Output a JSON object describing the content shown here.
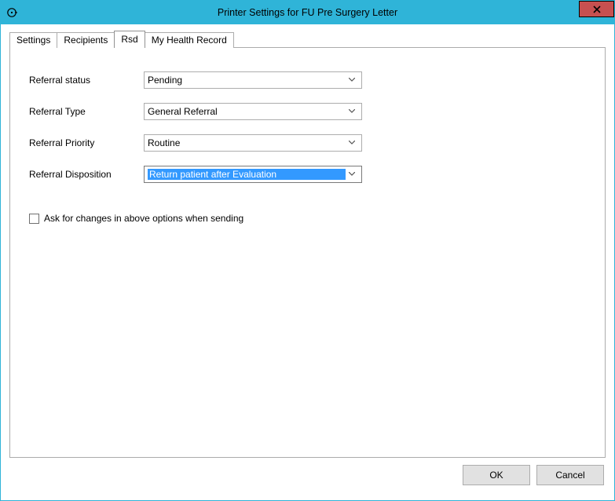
{
  "window": {
    "title": "Printer Settings for FU Pre Surgery Letter"
  },
  "tabs": [
    {
      "label": "Settings",
      "active": false
    },
    {
      "label": "Recipients",
      "active": false
    },
    {
      "label": "Rsd",
      "active": true
    },
    {
      "label": "My Health Record",
      "active": false
    }
  ],
  "form": {
    "referral_status": {
      "label": "Referral status",
      "value": "Pending"
    },
    "referral_type": {
      "label": "Referral Type",
      "value": "General Referral"
    },
    "referral_priority": {
      "label": "Referral Priority",
      "value": "Routine"
    },
    "referral_disposition": {
      "label": "Referral Disposition",
      "value": "Return patient after Evaluation"
    },
    "ask_checkbox": {
      "label": "Ask for changes in above options when sending",
      "checked": false
    }
  },
  "buttons": {
    "ok": "OK",
    "cancel": "Cancel"
  }
}
